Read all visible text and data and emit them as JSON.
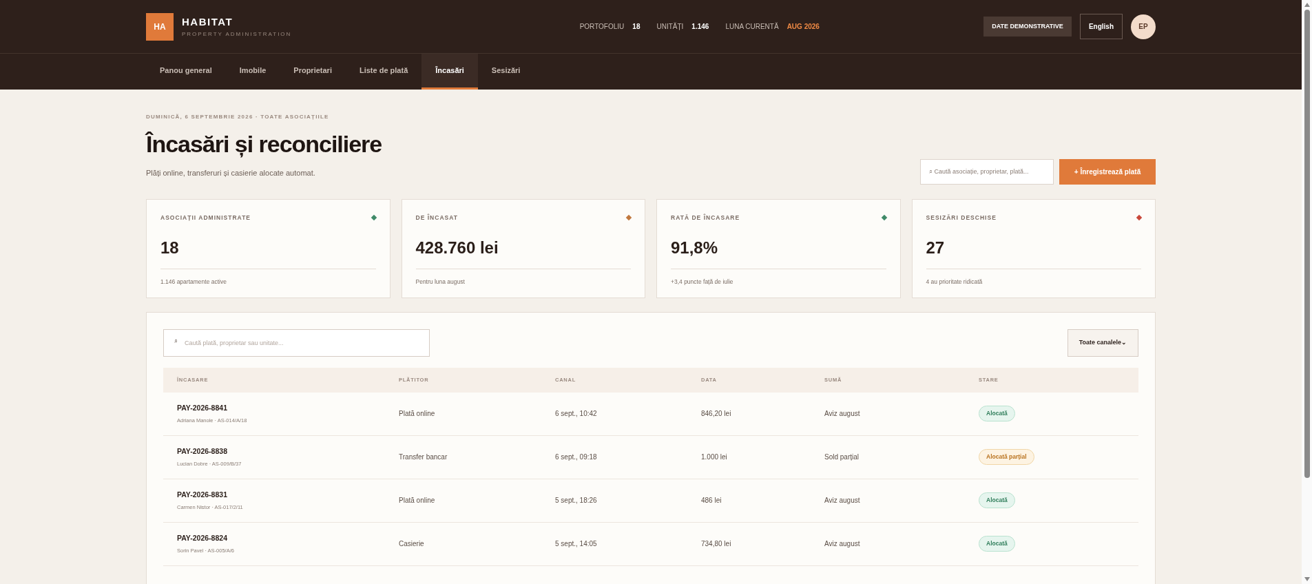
{
  "brand": {
    "logo": "HA",
    "name": "HABITAT",
    "tagline": "PROPERTY ADMINISTRATION"
  },
  "header_stats": [
    {
      "label": "PORTOFOLIU",
      "value": "18",
      "kind": "plain"
    },
    {
      "label": "UNITĂȚI",
      "value": "1.146",
      "kind": "plain"
    },
    {
      "label": "LUNA CURENTĂ",
      "value": "AUG 2026",
      "kind": "accent"
    }
  ],
  "demo_badge": "DATE DEMONSTRATIVE",
  "language_button": "English",
  "avatar": "EP",
  "tabs": [
    {
      "label": "Panou general",
      "selected": false
    },
    {
      "label": "Imobile",
      "selected": false
    },
    {
      "label": "Proprietari",
      "selected": false
    },
    {
      "label": "Liste de plată",
      "selected": false
    },
    {
      "label": "Încasări",
      "selected": true
    },
    {
      "label": "Sesizări",
      "selected": false
    }
  ],
  "eyebrow": "DUMINICĂ, 6 SEPTEMBRIE 2026 · TOATE ASOCIAȚIILE",
  "title": "Încasări și reconciliere",
  "subtitle": "Plăți online, transferuri și casierie alocate automat.",
  "global_search": {
    "placeholder": "⌕ Caută asociație, proprietar, plată..."
  },
  "record_button": "+ Înregistrează plată",
  "stat_cards": [
    {
      "label": "ASOCIAȚII ADMINISTRATE",
      "value": "18",
      "note": "1.146 apartamente active",
      "color": "#3f8a68"
    },
    {
      "label": "DE ÎNCASAT",
      "value": "428.760 lei",
      "note": "Pentru luna august",
      "color": "#c0783e"
    },
    {
      "label": "RATĂ DE ÎNCASARE",
      "value": "91,8%",
      "note": "+3,4 puncte față de iulie",
      "color": "#3f8a68"
    },
    {
      "label": "SESIZĂRI DESCHISE",
      "value": "27",
      "note": "4 au prioritate ridicată",
      "color": "#c9483a"
    }
  ],
  "table_search": {
    "icon": "⌕",
    "placeholder": "Caută plată, proprietar sau unitate..."
  },
  "channel_filter": {
    "value": "Toate canalele",
    "caret": "⌄"
  },
  "table": {
    "columns": [
      "ÎNCASARE",
      "PLĂTITOR",
      "CANAL",
      "DATA",
      "SUMĂ",
      "STARE"
    ],
    "rows": [
      {
        "id": "PAY-2026-8841",
        "sub": "Adriana Manole · AS-014/A/18",
        "payer": "Plată online",
        "channel": "6 sept., 10:42",
        "date": "846,20 lei",
        "amount": "Aviz august",
        "status": {
          "label": "Alocată",
          "kind": "allocated"
        }
      },
      {
        "id": "PAY-2026-8838",
        "sub": "Lucian Dobre · AS-009/B/37",
        "payer": "Transfer bancar",
        "channel": "6 sept., 09:18",
        "date": "1.000 lei",
        "amount": "Sold parțial",
        "status": {
          "label": "Alocată parțial",
          "kind": "partial"
        }
      },
      {
        "id": "PAY-2026-8831",
        "sub": "Carmen Nistor · AS-017/2/11",
        "payer": "Plată online",
        "channel": "5 sept., 18:26",
        "date": "486 lei",
        "amount": "Aviz august",
        "status": {
          "label": "Alocată",
          "kind": "allocated"
        }
      },
      {
        "id": "PAY-2026-8824",
        "sub": "Sorin Pavel · AS-005/A/6",
        "payer": "Casierie",
        "channel": "5 sept., 14:05",
        "date": "734,80 lei",
        "amount": "Aviz august",
        "status": {
          "label": "Alocată",
          "kind": "allocated"
        }
      }
    ]
  }
}
